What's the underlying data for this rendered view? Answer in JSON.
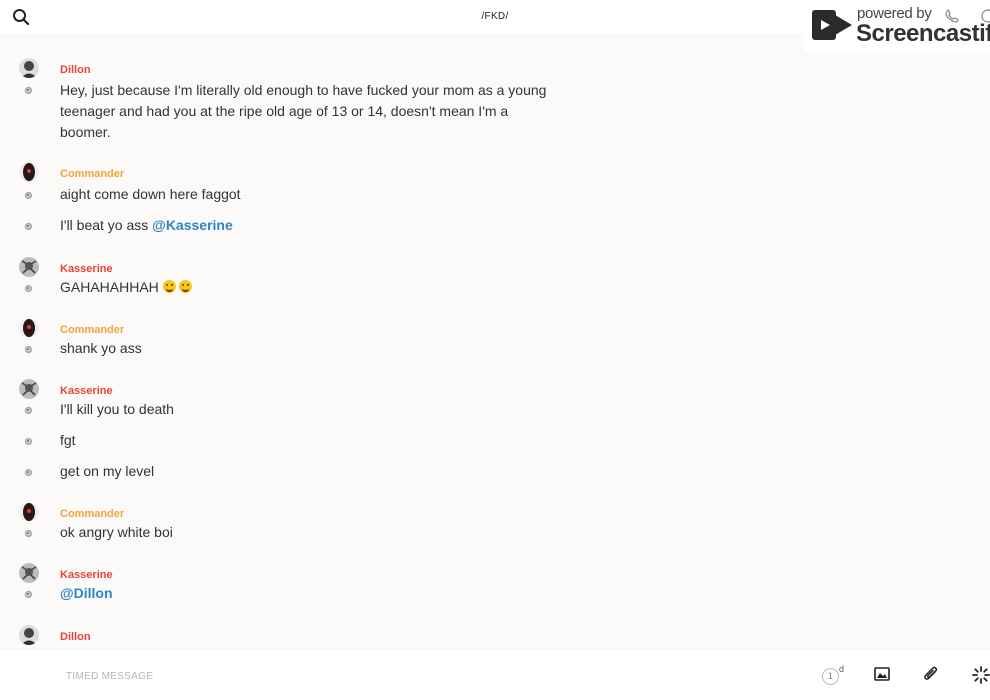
{
  "header": {
    "channel_title": "/FKD/",
    "search_icon": "search-icon"
  },
  "watermark": {
    "powered": "powered by",
    "brand": "Screencastify"
  },
  "messages": [
    {
      "author": "Dillon",
      "color": "#e8423a",
      "avatar": "dillon",
      "lines": [
        "Hey, just because I'm literally old enough to have fucked your mom as a young teenager and had you at the ripe old age of 13 or 14, doesn't mean I'm a boomer."
      ]
    },
    {
      "author": "Commander",
      "color": "#f0a43a",
      "avatar": "commander",
      "lines": [
        "aight come down here faggot",
        "I'll beat yo ass "
      ],
      "mention": "@Kasserine"
    },
    {
      "author": "Kasserine",
      "color": "#e8423a",
      "avatar": "kasserine",
      "lines": [
        "GAHAHAHHAH"
      ]
    },
    {
      "author": "Commander",
      "color": "#f0a43a",
      "avatar": "commander",
      "lines": [
        "shank yo ass"
      ]
    },
    {
      "author": "Kasserine",
      "color": "#e8423a",
      "avatar": "kasserine",
      "lines": [
        "I'll kill you to death",
        "fgt",
        "get on my level"
      ]
    },
    {
      "author": "Commander",
      "color": "#f0a43a",
      "avatar": "commander",
      "lines": [
        "ok angry white boi"
      ]
    },
    {
      "author": "Kasserine",
      "color": "#e8423a",
      "avatar": "kasserine",
      "mention": "@Dillon"
    },
    {
      "author": "Dillon",
      "color": "#e8423a",
      "avatar": "dillon"
    }
  ],
  "composer": {
    "placeholder": "TIMED MESSAGE",
    "timer_value": "1",
    "timer_unit": "d"
  }
}
